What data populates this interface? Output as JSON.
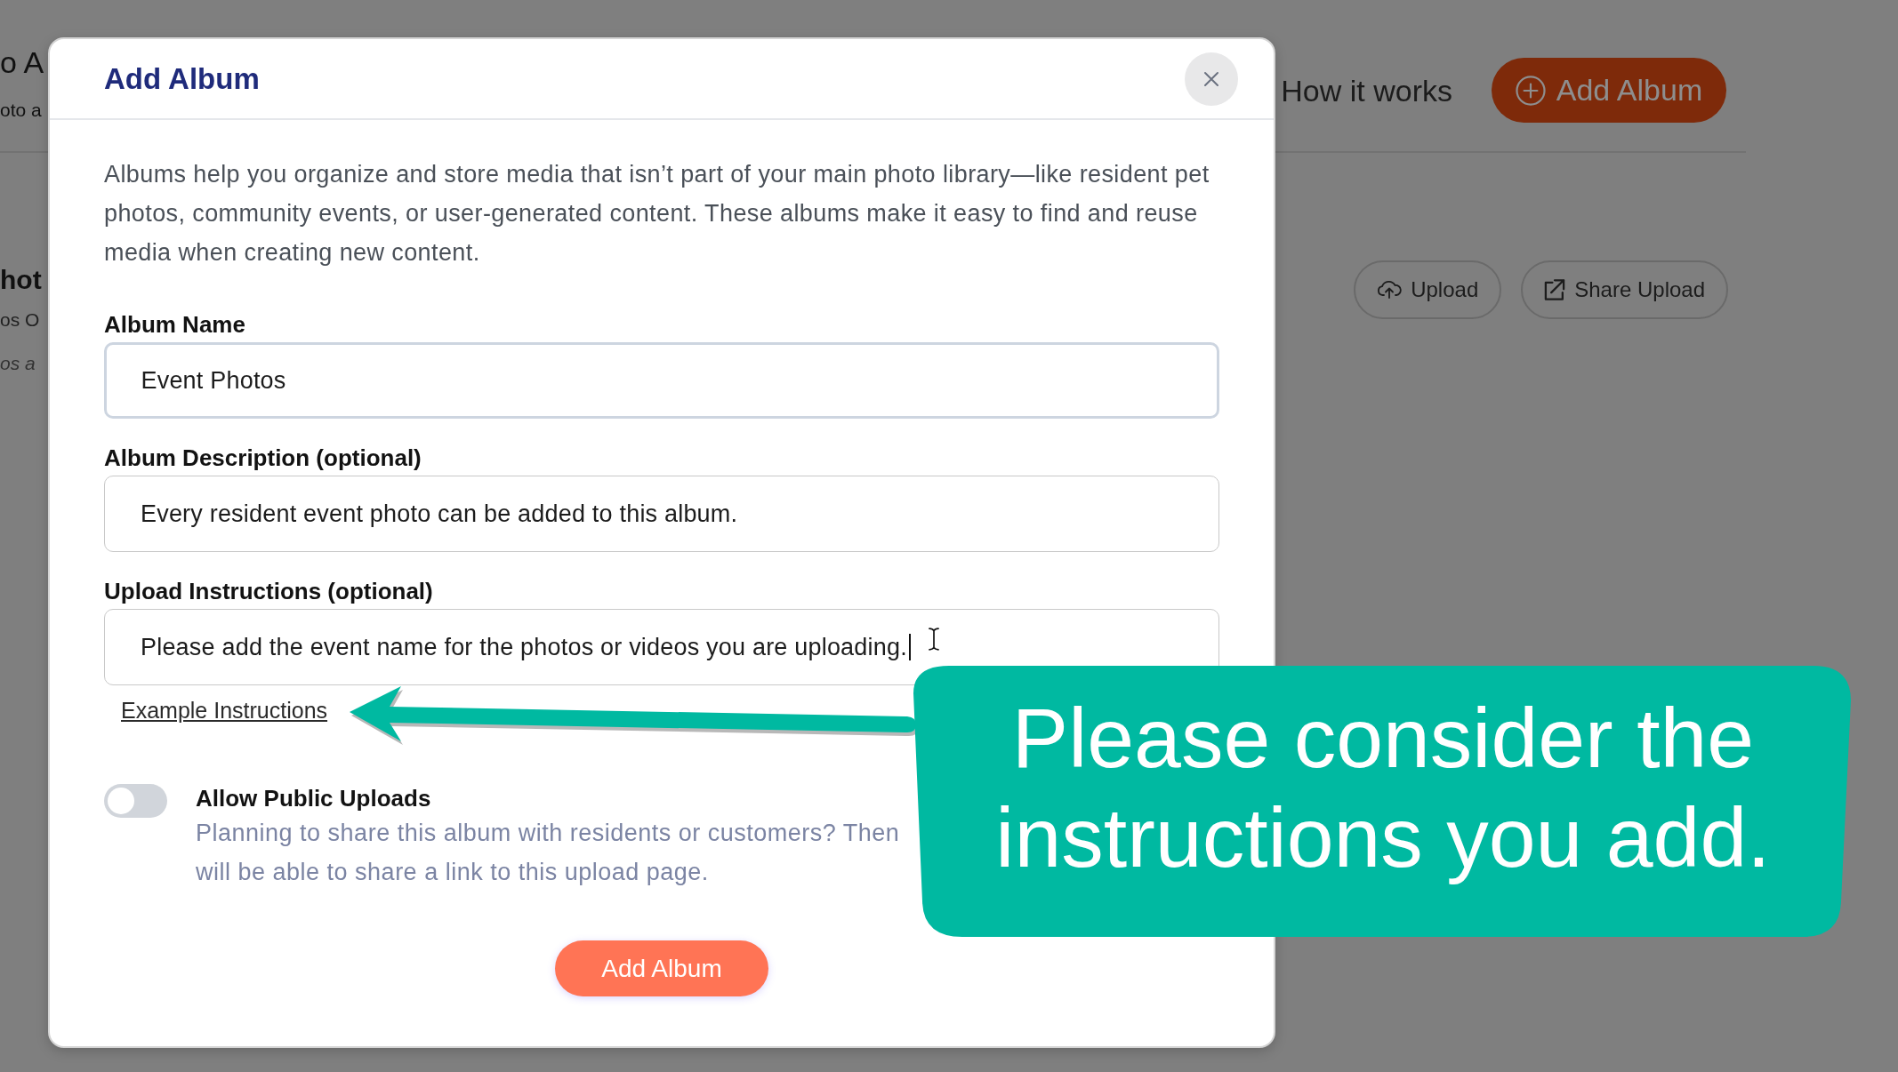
{
  "page": {
    "header": {
      "title_fragment": "o A",
      "subtitle_fragment": "oto a",
      "nav_link": "How it works",
      "add_button": {
        "label": "Add Album"
      }
    },
    "section": {
      "title_fragment": "hot",
      "text_fragments": [
        {
          "kind": "meta",
          "text": "os O"
        },
        {
          "kind": "note",
          "text": "os a"
        }
      ],
      "buttons": [
        {
          "kind": "upload",
          "label": "Upload"
        },
        {
          "kind": "share",
          "label": "Share Upload"
        }
      ]
    }
  },
  "modal": {
    "title": "Add Album",
    "description": "Albums help you organize and store media that isn’t part of your main photo library—like resident pet photos, community events, or user-generated content. These albums make it easy to find and reuse media when creating new content.",
    "fields": [
      {
        "label": "Album Name",
        "value": "Event Photos",
        "focused": true,
        "caret": false,
        "pointer": false
      },
      {
        "label": "Album Description (optional)",
        "value": "Every resident event photo can be added to this album.",
        "focused": false,
        "caret": false,
        "pointer": false
      },
      {
        "label": "Upload Instructions (optional)",
        "value": "Please add the event name for the photos or videos you are uploading.",
        "focused": false,
        "caret": true,
        "pointer": true
      }
    ],
    "example_link": "Example Instructions",
    "public_uploads": {
      "label": "Allow Public Uploads",
      "on": false,
      "description_lines": [
        "Planning to share this album with residents or customers? Then",
        "will be able to share a link to this upload page."
      ]
    },
    "submit_button": "Add Album"
  },
  "callout": {
    "text": "Please consider the instructions you add."
  }
}
